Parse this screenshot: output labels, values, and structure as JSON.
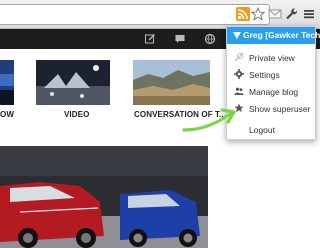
{
  "thumbnails": [
    {
      "label": "OW"
    },
    {
      "label": "VIDEO"
    },
    {
      "label": "CONVERSATION OF T..."
    }
  ],
  "user_menu": {
    "header": "Greg [Gawker Tech]",
    "items": [
      {
        "label": "Private view",
        "icon": "private-view-icon"
      },
      {
        "label": "Settings",
        "icon": "gear-icon"
      },
      {
        "label": "Manage blog",
        "icon": "people-icon"
      },
      {
        "label": "Show superuser",
        "icon": "star-icon"
      },
      {
        "label": "Logout",
        "icon": ""
      }
    ]
  },
  "colors": {
    "accent": "#2a9ff0",
    "header_bg": "#1d1d1d",
    "annotation": "#7bd44a",
    "rss": "#f39a1a"
  }
}
